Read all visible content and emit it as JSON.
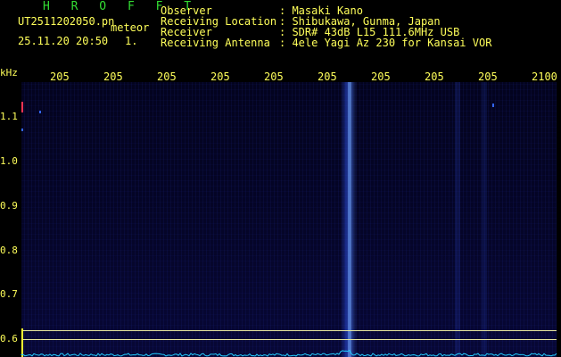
{
  "header": {
    "title": "H R O F F T",
    "filename": "UT2511202050.pn",
    "mode": "meteor",
    "datetime": "25.11.20 20:50",
    "count": "1.",
    "rows": [
      {
        "label": "Observer",
        "value": ": Masaki Kano"
      },
      {
        "label": "Receiving Location",
        "value": ": Shibukawa, Gunma, Japan"
      },
      {
        "label": "Receiver",
        "value": ": SDR# 43dB L15 111.6MHz USB"
      },
      {
        "label": "Receiving Antenna",
        "value": ": 4ele Yagi Az 230 for Kansai VOR"
      }
    ]
  },
  "axis": {
    "unit": "kHz",
    "x_ticks": [
      "205",
      "205",
      "205",
      "205",
      "205",
      "205",
      "205",
      "205",
      "205",
      "2100"
    ],
    "y_ticks": [
      "1.1",
      "1.0",
      "0.9",
      "0.8",
      "0.7",
      "0.6"
    ]
  },
  "colors": {
    "background": "#000000",
    "text": "#ffff5a",
    "title": "#33dd33",
    "trace": "#22ccff"
  }
}
